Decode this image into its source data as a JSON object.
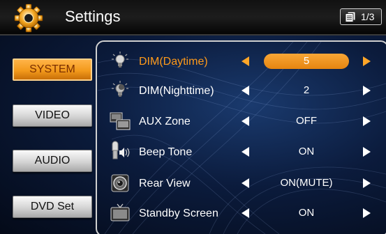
{
  "header": {
    "title": "Settings",
    "page_indicator": "1/3"
  },
  "sidebar": {
    "items": [
      {
        "label": "SYSTEM",
        "selected": true
      },
      {
        "label": "VIDEO",
        "selected": false
      },
      {
        "label": "AUDIO",
        "selected": false
      },
      {
        "label": "DVD Set",
        "selected": false
      }
    ]
  },
  "settings": [
    {
      "label": "DIM(Daytime)",
      "value": "5",
      "icon": "bulb-sun-icon",
      "active": true
    },
    {
      "label": "DIM(Nighttime)",
      "value": "2",
      "icon": "bulb-moon-icon",
      "active": false
    },
    {
      "label": "AUX Zone",
      "value": "OFF",
      "icon": "aux-zone-icon",
      "active": false
    },
    {
      "label": "Beep Tone",
      "value": "ON",
      "icon": "beep-speaker-icon",
      "active": false
    },
    {
      "label": "Rear View",
      "value": "ON(MUTE)",
      "icon": "rear-camera-icon",
      "active": false
    },
    {
      "label": "Standby Screen",
      "value": "ON",
      "icon": "standby-screen-icon",
      "active": false
    }
  ],
  "colors": {
    "accent": "#f39a1c",
    "active_label": "#ff9a1a",
    "background": "#0b1b3c"
  }
}
